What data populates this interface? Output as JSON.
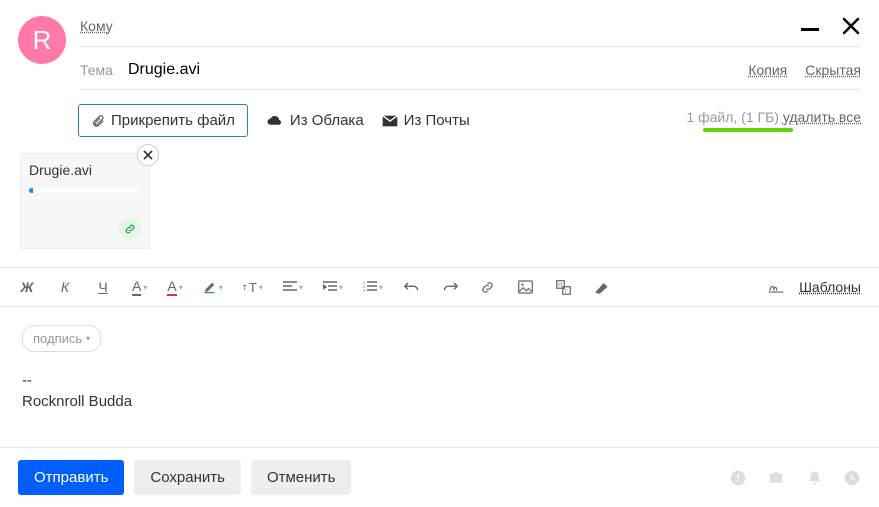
{
  "avatar_letter": "R",
  "labels": {
    "to": "Кому",
    "subject": "Тема",
    "cc": "Копия",
    "bcc": "Скрытая"
  },
  "subject_value": "Drugie.avi",
  "attach": {
    "attach_file": "Прикрепить файл",
    "from_cloud": "Из Облака",
    "from_mail": "Из Почты",
    "count_label": "1 файл, (1 ГБ)",
    "remove_all": "удалить все"
  },
  "file": {
    "name": "Drugie.avi"
  },
  "toolbar": {
    "bold": "Ж",
    "italic": "К",
    "underline": "Ч",
    "templates": "Шаблоны"
  },
  "signature": {
    "button": "подпись",
    "divider": "--",
    "name": "Rocknroll Budda"
  },
  "footer": {
    "send": "Отправить",
    "save": "Сохранить",
    "cancel": "Отменить"
  }
}
